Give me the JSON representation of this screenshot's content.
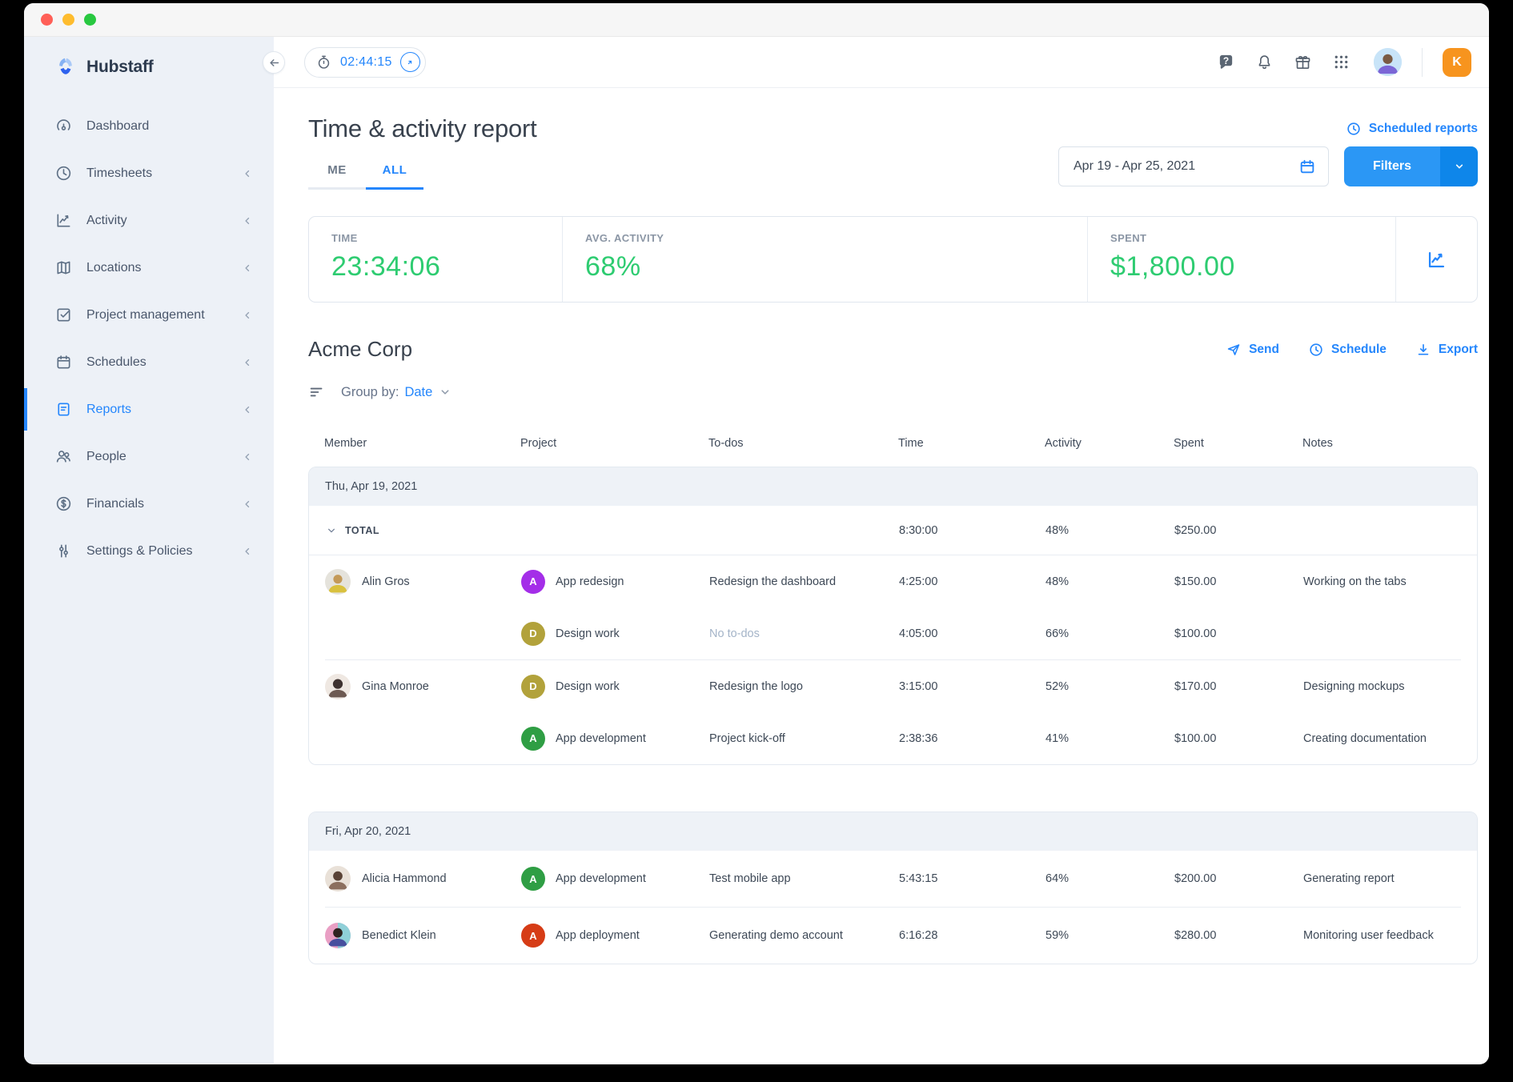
{
  "window": {
    "titlebar_buttons": [
      "close",
      "minimize",
      "zoom"
    ]
  },
  "brand": {
    "name": "Hubstaff"
  },
  "sidebar": {
    "items": [
      {
        "label": "Dashboard",
        "icon": "dashboard-icon",
        "active": false,
        "has_chevron": false
      },
      {
        "label": "Timesheets",
        "icon": "timesheets-icon",
        "active": false,
        "has_chevron": true
      },
      {
        "label": "Activity",
        "icon": "activity-icon",
        "active": false,
        "has_chevron": true
      },
      {
        "label": "Locations",
        "icon": "locations-icon",
        "active": false,
        "has_chevron": true
      },
      {
        "label": "Project management",
        "icon": "project-management-icon",
        "active": false,
        "has_chevron": true
      },
      {
        "label": "Schedules",
        "icon": "schedules-icon",
        "active": false,
        "has_chevron": true
      },
      {
        "label": "Reports",
        "icon": "reports-icon",
        "active": true,
        "has_chevron": true
      },
      {
        "label": "People",
        "icon": "people-icon",
        "active": false,
        "has_chevron": true
      },
      {
        "label": "Financials",
        "icon": "financials-icon",
        "active": false,
        "has_chevron": true
      },
      {
        "label": "Settings & Policies",
        "icon": "settings-icon",
        "active": false,
        "has_chevron": true
      }
    ]
  },
  "topbar": {
    "timer_value": "02:44:15",
    "user_initial": "K"
  },
  "page": {
    "title": "Time & activity report",
    "scheduled_reports_label": "Scheduled reports",
    "tabs": [
      {
        "label": "ME",
        "active": false
      },
      {
        "label": "ALL",
        "active": true
      }
    ],
    "date_range": "Apr 19 - Apr 25, 2021",
    "filters_label": "Filters"
  },
  "stats": {
    "time": {
      "label": "TIME",
      "value": "23:34:06"
    },
    "avg_activity": {
      "label": "AVG. ACTIVITY",
      "value": "68%"
    },
    "spent": {
      "label": "SPENT",
      "value": "$1,800.00"
    }
  },
  "report": {
    "organization": "Acme Corp",
    "send_label": "Send",
    "schedule_label": "Schedule",
    "export_label": "Export",
    "group_by_label": "Group by:",
    "group_by_value": "Date"
  },
  "table": {
    "columns": [
      "Member",
      "Project",
      "To-dos",
      "Time",
      "Activity",
      "Spent",
      "Notes"
    ],
    "groups": [
      {
        "date": "Thu, Apr 19, 2021",
        "total": {
          "label": "TOTAL",
          "time": "8:30:00",
          "activity": "48%",
          "spent": "$250.00"
        },
        "rows": [
          {
            "member": "Alin Gros",
            "project": "App redesign",
            "badge_letter": "A",
            "badge_color": "#a42ee8",
            "todo": "Redesign the dashboard",
            "time": "4:25:00",
            "activity": "48%",
            "spent": "$150.00",
            "notes": "Working on the tabs"
          },
          {
            "member": "",
            "project": "Design work",
            "badge_letter": "D",
            "badge_color": "#b2a23b",
            "todo": "No to-dos",
            "time": "4:05:00",
            "activity": "66%",
            "spent": "$100.00",
            "notes": ""
          },
          {
            "member": "Gina Monroe",
            "project": "Design work",
            "badge_letter": "D",
            "badge_color": "#b2a23b",
            "todo": "Redesign the logo",
            "time": "3:15:00",
            "activity": "52%",
            "spent": "$170.00",
            "notes": "Designing mockups"
          },
          {
            "member": "",
            "project": "App development",
            "badge_letter": "A",
            "badge_color": "#2f9e44",
            "todo": "Project kick-off",
            "time": "2:38:36",
            "activity": "41%",
            "spent": "$100.00",
            "notes": "Creating documentation"
          }
        ]
      },
      {
        "date": "Fri, Apr 20, 2021",
        "rows": [
          {
            "member": "Alicia Hammond",
            "project": "App development",
            "badge_letter": "A",
            "badge_color": "#2f9e44",
            "todo": "Test mobile app",
            "time": "5:43:15",
            "activity": "64%",
            "spent": "$200.00",
            "notes": "Generating report"
          },
          {
            "member": "Benedict Klein",
            "project": "App deployment",
            "badge_letter": "A",
            "badge_color": "#d63c16",
            "todo": "Generating demo account",
            "time": "6:16:28",
            "activity": "59%",
            "spent": "$280.00",
            "notes": "Monitoring user feedback"
          }
        ]
      }
    ]
  },
  "colors": {
    "accent_blue": "#2486fc",
    "stat_green": "#2ecc71",
    "filters_button": "#2b97f5",
    "filters_caret": "#0e86ea",
    "user_badge_orange": "#f7941e",
    "sidebar_bg": "#edf1f7",
    "group_header_bg": "#eef2f7"
  }
}
